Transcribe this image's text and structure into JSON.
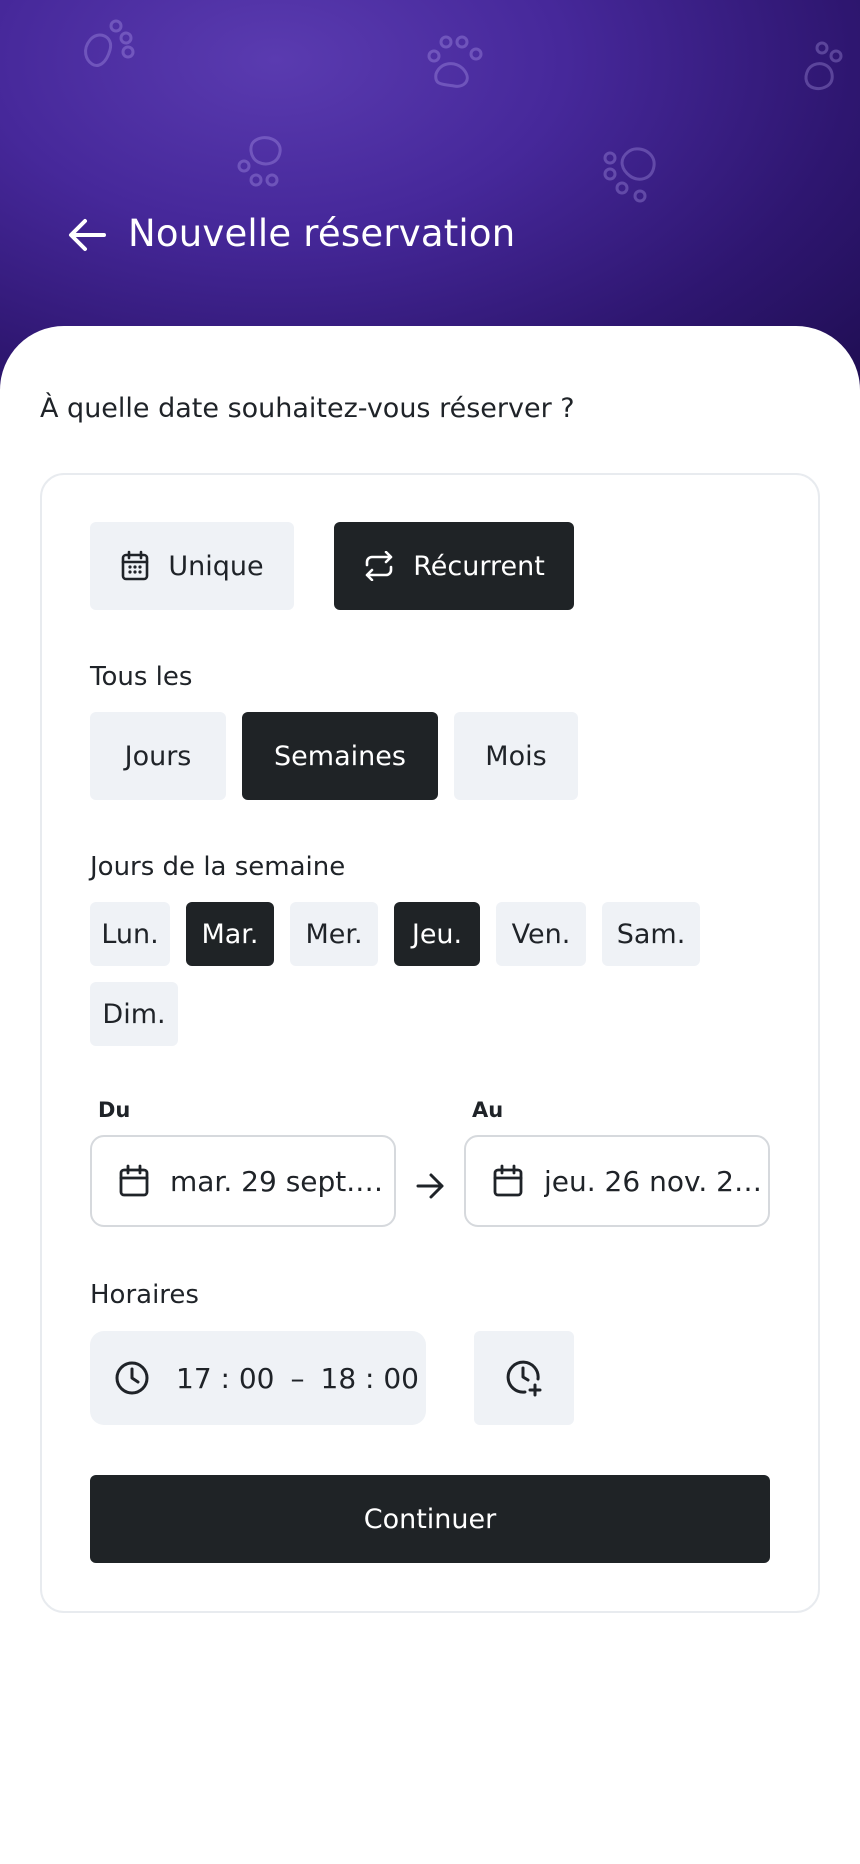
{
  "header": {
    "title": "Nouvelle réservation",
    "back_icon": "arrow-left-icon",
    "background_colors": [
      "#5a3bb0",
      "#2e1670",
      "#1e0d50"
    ]
  },
  "question": "À quelle date souhaitez-vous réserver ?",
  "mode_toggle": {
    "unique_label": "Unique",
    "recurrent_label": "Récurrent",
    "selected": "Récurrent"
  },
  "frequency": {
    "label": "Tous les",
    "options": [
      "Jours",
      "Semaines",
      "Mois"
    ],
    "selected": "Semaines"
  },
  "weekdays": {
    "label": "Jours de la semaine",
    "days": [
      "Lun.",
      "Mar.",
      "Mer.",
      "Jeu.",
      "Ven.",
      "Sam.",
      "Dim."
    ],
    "selected": [
      "Mar.",
      "Jeu."
    ]
  },
  "date_range": {
    "from_label": "Du",
    "from_value": "mar. 29 sept. 2…",
    "to_label": "Au",
    "to_value": "jeu. 26 nov. 20…"
  },
  "schedule": {
    "label": "Horaires",
    "start": "17 : 00",
    "separator": "–",
    "end": "18 : 00"
  },
  "continue_label": "Continuer",
  "colors": {
    "accent_dark": "#1f2326",
    "chip_light": "#eff2f6",
    "header_purple": "#46289a"
  }
}
